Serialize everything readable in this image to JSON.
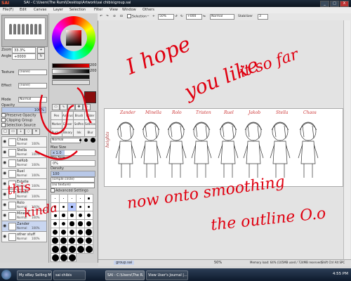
{
  "window": {
    "app_name": "SAI",
    "title": "SAI - C:\\Users\\The Rumi\\Desktop\\Artwork\\sai chibis\\group.sai",
    "controls": [
      "_",
      "□",
      "X"
    ]
  },
  "menubar": [
    "File(F)",
    "Edit",
    "Canvas",
    "Layer",
    "Selection",
    "Filter",
    "View",
    "Window",
    "Others"
  ],
  "toolbar": {
    "selection_label": "Selection",
    "zoom": "50%",
    "angle_value": "+000",
    "mode": "Normal",
    "stabilizer_label": "Stabilizer",
    "stabilizer_value": "3"
  },
  "navigator": {
    "zoom_label": "Zoom",
    "zoom_value": "33.3%",
    "angle_label": "Angle",
    "angle_value": "+0000"
  },
  "layer_panel": {
    "texture_label": "Texture",
    "texture_value": "(none)",
    "effect_label": "Effect",
    "effect_value": "(none)",
    "mode_label": "Mode",
    "mode_value": "Normal",
    "opacity_label": "Opacity",
    "opacity_value": "100%",
    "preserve_opacity": "Preserve Opacity",
    "clipping_group": "Clipping Group",
    "selection_source": "Selection Source",
    "layers": [
      {
        "name": "Chaos",
        "mode": "Normal",
        "opacity": "100%"
      },
      {
        "name": "Stella",
        "mode": "Normal",
        "opacity": "100%"
      },
      {
        "name": "taiKob",
        "mode": "Normal",
        "opacity": "100%"
      },
      {
        "name": "Ruel",
        "mode": "Normal",
        "opacity": "100%"
      },
      {
        "name": "Estelle",
        "mode": "Normal",
        "opacity": "100%"
      },
      {
        "name": "Tristen",
        "mode": "Normal",
        "opacity": "100%"
      },
      {
        "name": "Rolo",
        "mode": "Normal",
        "opacity": "100%"
      },
      {
        "name": "Minella",
        "mode": "Normal",
        "opacity": "100%"
      },
      {
        "name": "Zander",
        "mode": "Normal",
        "opacity": "100%"
      },
      {
        "name": "other stuff",
        "mode": "Normal",
        "opacity": "100%"
      }
    ]
  },
  "color_panel": {
    "h_value": "200",
    "s_value": "200"
  },
  "tool_panel": {
    "tools": [
      "Pen",
      "AirBrush",
      "Brush",
      "Water",
      "Marker",
      "Eraser",
      "SelPen",
      "SelErase",
      "Bucket",
      "Binary",
      "Ink",
      "Blur"
    ],
    "normal_label": "Normal",
    "max_size_label": "Max Size",
    "max_size_value": "x 1.0",
    "min_size_label": "Min Size",
    "min_size_value": "0%",
    "density_label": "Density",
    "density_value": "100",
    "shape_value": "(simple circle)",
    "texture_value": "(no texture)",
    "advanced_settings": "Advanced Settings",
    "brush_sizes": [
      "0.7",
      "0.8",
      "1",
      "1.5",
      "2",
      "2.3",
      "2.6",
      "3",
      "3.5",
      "4",
      "5",
      "6",
      "7",
      "8",
      "9",
      "10",
      "12",
      "14",
      "16",
      "20",
      "25",
      "30",
      "35",
      "40",
      "50",
      "60",
      "70",
      "80",
      "100",
      "120",
      "160",
      "200",
      "250",
      "300",
      "350",
      "400",
      "450",
      "500"
    ]
  },
  "canvas": {
    "character_names": [
      "Zander",
      "Minella",
      "Rolo",
      "Tristen",
      "Ruel",
      "Jakob",
      "Stella",
      "Chaos"
    ],
    "side_label": "heights",
    "annotation_1": "I hope",
    "annotation_2": "you like",
    "annotation_3": "it so far",
    "annotation_4": "now onto smoothing",
    "annotation_5": "the outline O.o",
    "annotation_6": "this",
    "annotation_7": "kinda"
  },
  "statusbar": {
    "file_tab": "group.sai",
    "file_zoom": "50%",
    "memory": "Memory load: 64% (105MB used / 724MB reserved)",
    "keys": "Shift Ctrl Alt SPC"
  },
  "taskbar": {
    "tasks": [
      "My eBay Selling Ma...",
      "sai chibis",
      "SAI - C:\\Users\\The R...",
      "View User's Journal |..."
    ],
    "clock": "4:55 PM"
  },
  "colors": {
    "annotation_red": "#e00010",
    "taskbar": "#0d1a2c",
    "primary_color": "#8a0d0d"
  }
}
